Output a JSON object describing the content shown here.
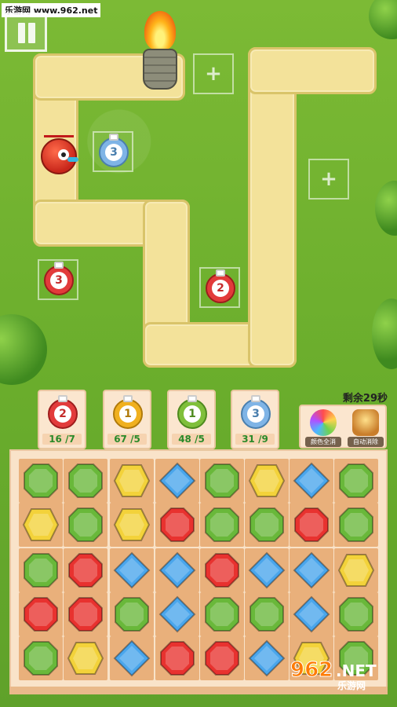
{
  "watermark_top": "乐游网 www.962.net",
  "hud": {
    "time_remaining": "剩余29秒"
  },
  "tower_cards": [
    {
      "number": "2",
      "count": "16 /7",
      "color": "#e23b3b",
      "count_color": "#2a8a2a"
    },
    {
      "number": "1",
      "count": "67 /5",
      "color": "#f0b01e",
      "count_color": "#2a8a2a"
    },
    {
      "number": "1",
      "count": "48 /5",
      "color": "#7fbf3a",
      "count_color": "#2a8a2a"
    },
    {
      "number": "3",
      "count": "31 /9",
      "color": "#7fb4e6",
      "count_color": "#2a8a2a"
    }
  ],
  "powerups": [
    {
      "label": "颜色全消",
      "icon": "rainbow-orb-icon"
    },
    {
      "label": "自动消除",
      "icon": "hourglass-icon"
    }
  ],
  "placed_towers": [
    {
      "number": "3",
      "color": "#7fb4e6"
    },
    {
      "number": "3",
      "color": "#e23b3b"
    },
    {
      "number": "2",
      "color": "#e23b3b"
    }
  ],
  "gem_colors": {
    "green": "#69b83a",
    "yellow": "#f3d23a",
    "blue": "#4aa6ec",
    "red": "#e8322f"
  },
  "board": [
    [
      "green",
      "green",
      "yellow",
      "blue",
      "green",
      "yellow",
      "blue",
      "green"
    ],
    [
      "yellow",
      "green",
      "yellow",
      "red",
      "green",
      "green",
      "red",
      "green"
    ],
    [
      "green",
      "red",
      "blue",
      "blue",
      "red",
      "blue",
      "blue",
      "yellow"
    ],
    [
      "red",
      "red",
      "green",
      "blue",
      "green",
      "green",
      "blue",
      "green"
    ],
    [
      "green",
      "yellow",
      "blue",
      "red",
      "red",
      "blue",
      "yellow",
      "green"
    ]
  ],
  "logo": {
    "big": "962",
    "net": ".NET",
    "cn": "乐游网"
  }
}
